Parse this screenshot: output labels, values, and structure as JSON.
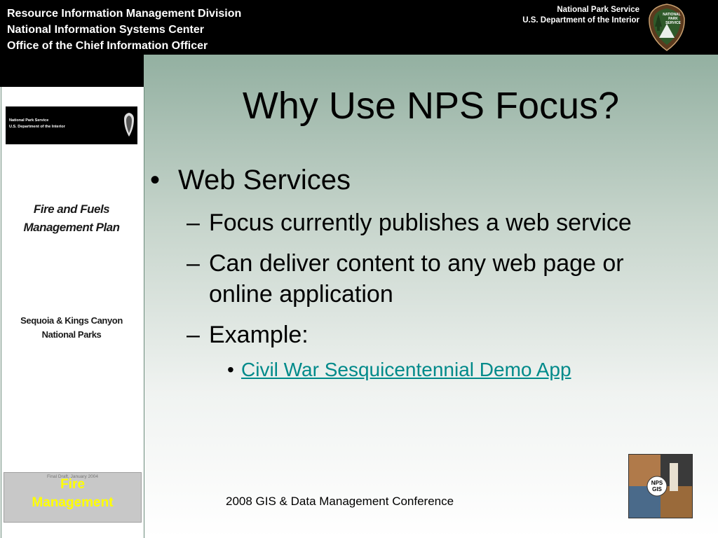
{
  "header": {
    "left_lines": [
      "Resource Information Management Division",
      "National Information Systems Center",
      "Office of the Chief Information Officer"
    ],
    "right_lines": [
      "National Park Service",
      "U.S. Department of the Interior"
    ],
    "logo_text": [
      "NATIONAL",
      "PARK",
      "SERVICE"
    ]
  },
  "left_panel": {
    "banner_lines": [
      "National Park Service",
      "U.S. Department of the Interior"
    ],
    "title_lines": [
      "Fire and Fuels",
      "Management Plan"
    ],
    "subtitle_lines": [
      "Sequoia & Kings Canyon",
      "National Parks"
    ],
    "small_text": "Final Draft, January 2004",
    "badge_lines": [
      "Fire",
      "Management"
    ]
  },
  "slide": {
    "title": "Why Use NPS Focus?",
    "bullet_mark": "•",
    "dash_mark": "–",
    "level1": "Web Services",
    "level2": [
      "Focus currently publishes a web service",
      "Can deliver content to any web page or online application",
      "Example:"
    ],
    "level3_link": "Civil War Sesquicentennial Demo App"
  },
  "footer": {
    "text": "2008 GIS & Data Management Conference",
    "gis_logo_text": [
      "NPS",
      "GIS"
    ]
  },
  "colors": {
    "header_bg": "#000000",
    "link": "#008a8a",
    "badge_text": "#ffff00",
    "gradient_top": "#93b0a1"
  }
}
